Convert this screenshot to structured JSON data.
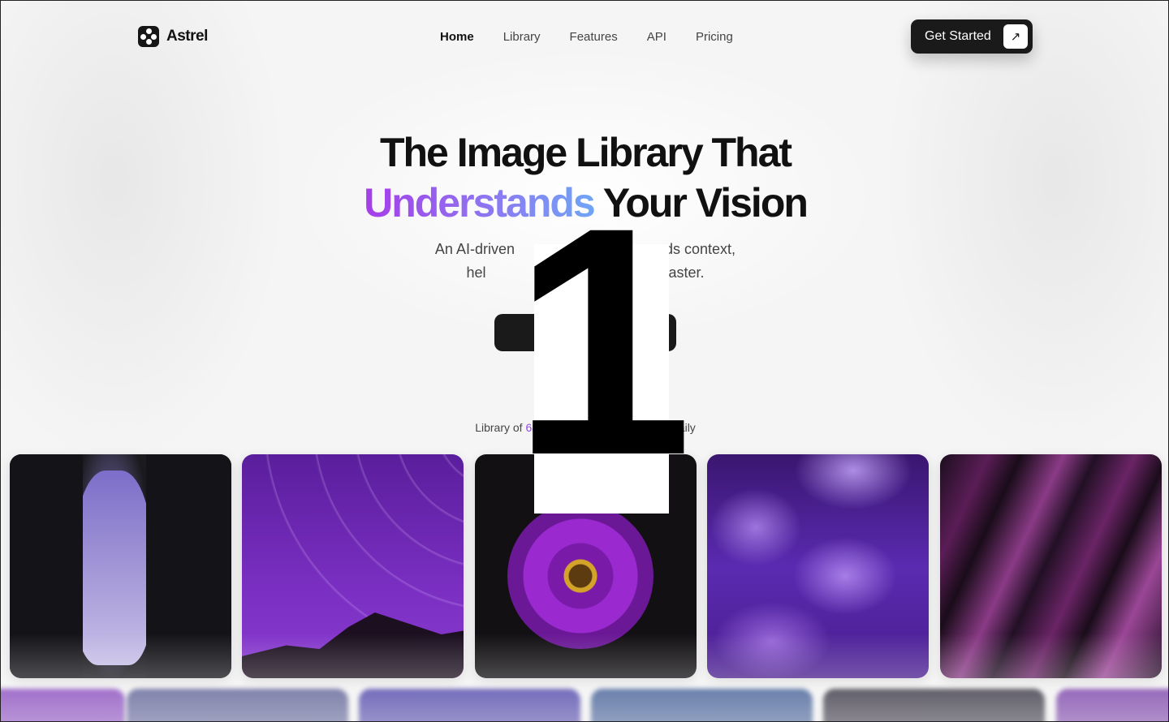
{
  "brand": {
    "name": "Astrel",
    "icon": "flower-logo-icon"
  },
  "nav": {
    "items": [
      {
        "label": "Home",
        "active": true
      },
      {
        "label": "Library",
        "active": false
      },
      {
        "label": "Features",
        "active": false
      },
      {
        "label": "API",
        "active": false
      },
      {
        "label": "Pricing",
        "active": false
      }
    ],
    "cta_label": "Get Started",
    "cta_icon": "arrow-up-right-icon"
  },
  "hero": {
    "title_line1": "The Image Library That",
    "title_highlight": "Understands",
    "title_rest": " Your Vision",
    "subtitle_line1": "An AI-driven ",
    "subtitle_line1_end": "ands context,",
    "subtitle_line2": "hel",
    "subtitle_line2_end": "faster.",
    "stat_prefix": "Library of ",
    "stat_number": "68",
    "stat_suffix": "daily"
  },
  "overlay": {
    "number": "1"
  },
  "colors": {
    "accent": "#9b45e6",
    "dark": "#1a1a1a"
  },
  "gallery": {
    "row1": [
      "rock-silhouette-sky",
      "star-trails-purple",
      "purple-dahlia-flower",
      "purple-jellyfish",
      "purple-foil-texture"
    ]
  }
}
